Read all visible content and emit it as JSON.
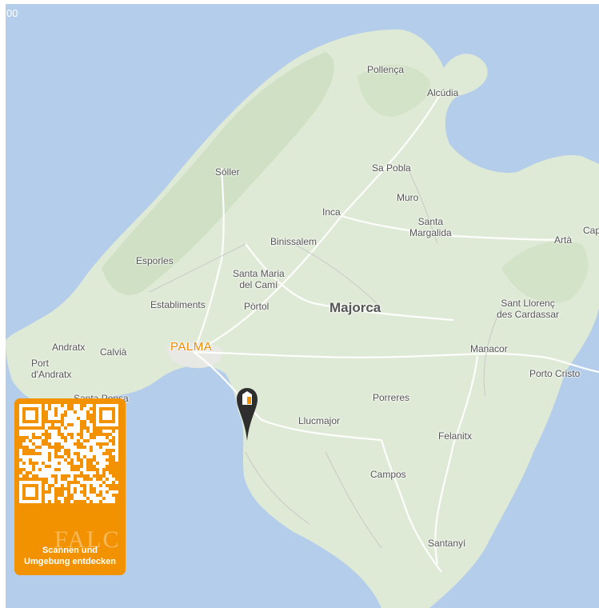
{
  "map": {
    "corner_text": "00",
    "region_label": "Majorca",
    "capital_label": "PALMA",
    "places": [
      {
        "id": "pollenca",
        "name": "Pollença"
      },
      {
        "id": "alcudia",
        "name": "Alcúdia"
      },
      {
        "id": "soller",
        "name": "Sóller"
      },
      {
        "id": "sapobla",
        "name": "Sa Pobla"
      },
      {
        "id": "muro",
        "name": "Muro"
      },
      {
        "id": "inca",
        "name": "Inca"
      },
      {
        "id": "santamargalida",
        "name": "Santa\nMargalida"
      },
      {
        "id": "binissalem",
        "name": "Binissalem"
      },
      {
        "id": "arta",
        "name": "Artà"
      },
      {
        "id": "capdepera",
        "name": "Cap"
      },
      {
        "id": "esporles",
        "name": "Esporles"
      },
      {
        "id": "santamaria",
        "name": "Santa Maria\ndel Camí"
      },
      {
        "id": "establiments",
        "name": "Establiments"
      },
      {
        "id": "portol",
        "name": "Pòrtol"
      },
      {
        "id": "santllorenc",
        "name": "Sant Llorenç\ndes Cardassar"
      },
      {
        "id": "andratx",
        "name": "Andratx"
      },
      {
        "id": "calvia",
        "name": "Calvià"
      },
      {
        "id": "portdandratx",
        "name": "Port\nd'Andratx"
      },
      {
        "id": "manacor",
        "name": "Manacor"
      },
      {
        "id": "portocristo",
        "name": "Porto Cristo"
      },
      {
        "id": "santaponsa",
        "name": "Santa Ponsa"
      },
      {
        "id": "porreres",
        "name": "Porreres"
      },
      {
        "id": "llucmajor",
        "name": "Llucmajor"
      },
      {
        "id": "felanitx",
        "name": "Felanitx"
      },
      {
        "id": "campos",
        "name": "Campos"
      },
      {
        "id": "santanyi",
        "name": "Santanyí"
      }
    ],
    "marker": {
      "name": "property-location",
      "icon": "building-icon"
    }
  },
  "qr_card": {
    "caption_line1": "Scannen und",
    "caption_line2": "Umgebung entdecken",
    "watermark": "FALC",
    "accent": "#f39200"
  },
  "colors": {
    "sea": "#b3cdea",
    "land": "#dfead6",
    "land_dark": "#cfe0c4",
    "road": "#ffffff",
    "marker": "#2e2e2e"
  }
}
